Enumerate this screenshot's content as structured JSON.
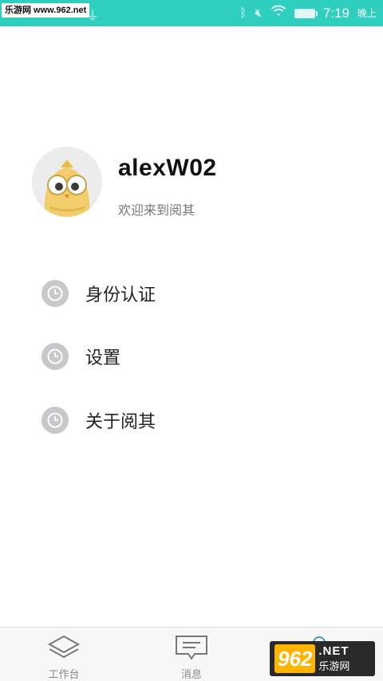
{
  "watermark": {
    "top_text": "乐游网 www.962.net",
    "bottom_badge": "962",
    "bottom_net": ".NET",
    "bottom_name": "乐游网"
  },
  "status_bar": {
    "time": "7:19",
    "period": "晚上",
    "background": "#2fcfc0"
  },
  "profile": {
    "username": "alexW02",
    "welcome": "欢迎来到阅其"
  },
  "menu": {
    "items": [
      {
        "label": "身份认证",
        "icon": "clock-icon"
      },
      {
        "label": "设置",
        "icon": "clock-icon"
      },
      {
        "label": "关于阅其",
        "icon": "clock-icon"
      }
    ]
  },
  "tabs": [
    {
      "label": "工作台",
      "icon": "layers-icon"
    },
    {
      "label": "消息",
      "icon": "message-icon"
    },
    {
      "label": "",
      "icon": "profile-icon"
    }
  ]
}
